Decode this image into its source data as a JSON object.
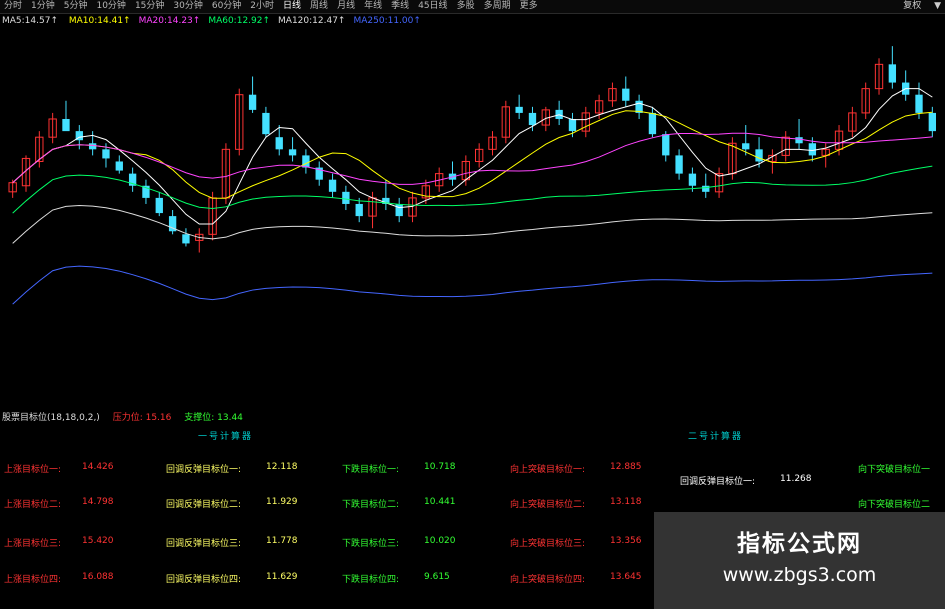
{
  "topbar": {
    "tabs": [
      "分时",
      "1分钟",
      "5分钟",
      "10分钟",
      "15分钟",
      "30分钟",
      "60分钟",
      "2小时",
      "日线",
      "周线",
      "月线",
      "年线",
      "季线",
      "45日线",
      "多股",
      "多周期",
      "更多"
    ],
    "active": "日线",
    "right": [
      "复权",
      "▼"
    ]
  },
  "ma_legend": {
    "name": "MA5:14.57↑",
    "items": [
      {
        "label": "MA10:14.41↑",
        "color": "#ffff00"
      },
      {
        "label": "MA20:14.23↑",
        "color": "#ff44ff"
      },
      {
        "label": "MA60:12.92↑",
        "color": "#00ff66"
      },
      {
        "label": "MA120:12.47↑",
        "color": "#dddddd"
      },
      {
        "label": "MA250:11.00↑",
        "color": "#4466ff"
      }
    ]
  },
  "chart_data": {
    "type": "candlestick",
    "ylim": [
      10.5,
      16.2
    ],
    "candles": [
      [
        13.6,
        13.8,
        13.5,
        13.75
      ],
      [
        13.7,
        14.2,
        13.6,
        14.15
      ],
      [
        14.1,
        14.6,
        14.0,
        14.5
      ],
      [
        14.5,
        14.9,
        14.4,
        14.8
      ],
      [
        14.8,
        15.1,
        14.7,
        14.6
      ],
      [
        14.6,
        14.7,
        14.3,
        14.45
      ],
      [
        14.4,
        14.6,
        14.2,
        14.3
      ],
      [
        14.3,
        14.4,
        14.0,
        14.15
      ],
      [
        14.1,
        14.2,
        13.9,
        13.95
      ],
      [
        13.9,
        14.0,
        13.6,
        13.7
      ],
      [
        13.7,
        13.8,
        13.4,
        13.5
      ],
      [
        13.5,
        13.6,
        13.2,
        13.25
      ],
      [
        13.2,
        13.3,
        12.9,
        12.95
      ],
      [
        12.9,
        13.0,
        12.7,
        12.75
      ],
      [
        12.8,
        13.0,
        12.6,
        12.9
      ],
      [
        12.9,
        13.6,
        12.8,
        13.5
      ],
      [
        13.5,
        14.4,
        13.4,
        14.3
      ],
      [
        14.3,
        15.3,
        14.2,
        15.2
      ],
      [
        15.2,
        15.5,
        14.9,
        14.95
      ],
      [
        14.9,
        15.0,
        14.5,
        14.55
      ],
      [
        14.5,
        14.7,
        14.2,
        14.3
      ],
      [
        14.3,
        14.5,
        14.1,
        14.2
      ],
      [
        14.2,
        14.3,
        13.9,
        14.0
      ],
      [
        14.0,
        14.1,
        13.7,
        13.8
      ],
      [
        13.8,
        13.9,
        13.5,
        13.6
      ],
      [
        13.6,
        13.7,
        13.3,
        13.4
      ],
      [
        13.4,
        13.5,
        13.1,
        13.2
      ],
      [
        13.2,
        13.6,
        13.0,
        13.5
      ],
      [
        13.5,
        13.8,
        13.3,
        13.4
      ],
      [
        13.4,
        13.5,
        13.1,
        13.2
      ],
      [
        13.2,
        13.6,
        13.1,
        13.5
      ],
      [
        13.5,
        13.8,
        13.4,
        13.7
      ],
      [
        13.7,
        14.0,
        13.6,
        13.9
      ],
      [
        13.9,
        14.1,
        13.7,
        13.8
      ],
      [
        13.8,
        14.2,
        13.7,
        14.1
      ],
      [
        14.1,
        14.4,
        14.0,
        14.3
      ],
      [
        14.3,
        14.6,
        14.2,
        14.5
      ],
      [
        14.5,
        15.1,
        14.4,
        15.0
      ],
      [
        15.0,
        15.2,
        14.8,
        14.9
      ],
      [
        14.9,
        15.0,
        14.6,
        14.7
      ],
      [
        14.7,
        15.0,
        14.6,
        14.95
      ],
      [
        14.95,
        15.1,
        14.7,
        14.8
      ],
      [
        14.8,
        14.9,
        14.5,
        14.6
      ],
      [
        14.6,
        15.0,
        14.5,
        14.9
      ],
      [
        14.9,
        15.2,
        14.8,
        15.1
      ],
      [
        15.1,
        15.4,
        15.0,
        15.3
      ],
      [
        15.3,
        15.5,
        15.0,
        15.1
      ],
      [
        15.1,
        15.2,
        14.8,
        14.9
      ],
      [
        14.9,
        15.0,
        14.5,
        14.55
      ],
      [
        14.55,
        14.6,
        14.1,
        14.2
      ],
      [
        14.2,
        14.3,
        13.8,
        13.9
      ],
      [
        13.9,
        14.0,
        13.6,
        13.7
      ],
      [
        13.7,
        13.9,
        13.5,
        13.6
      ],
      [
        13.6,
        14.0,
        13.5,
        13.9
      ],
      [
        13.9,
        14.5,
        13.8,
        14.4
      ],
      [
        14.4,
        14.7,
        14.2,
        14.3
      ],
      [
        14.3,
        14.5,
        14.0,
        14.1
      ],
      [
        14.1,
        14.3,
        13.9,
        14.2
      ],
      [
        14.2,
        14.6,
        14.1,
        14.5
      ],
      [
        14.5,
        14.8,
        14.3,
        14.4
      ],
      [
        14.4,
        14.5,
        14.1,
        14.2
      ],
      [
        14.2,
        14.4,
        14.0,
        14.3
      ],
      [
        14.3,
        14.7,
        14.2,
        14.6
      ],
      [
        14.6,
        15.0,
        14.5,
        14.9
      ],
      [
        14.9,
        15.4,
        14.8,
        15.3
      ],
      [
        15.3,
        15.8,
        15.2,
        15.7
      ],
      [
        15.7,
        16.0,
        15.3,
        15.4
      ],
      [
        15.4,
        15.6,
        15.1,
        15.2
      ],
      [
        15.2,
        15.4,
        14.8,
        14.9
      ],
      [
        14.9,
        15.0,
        14.5,
        14.6
      ]
    ],
    "ma_lines": [
      {
        "name": "MA5",
        "color": "#ffffff"
      },
      {
        "name": "MA10",
        "color": "#ffff00"
      },
      {
        "name": "MA20",
        "color": "#ff44ff"
      },
      {
        "name": "MA60",
        "color": "#00ff66"
      },
      {
        "name": "MA120",
        "color": "#dddddd"
      },
      {
        "name": "MA250",
        "color": "#4466ff"
      }
    ]
  },
  "lower_header": {
    "name": "股票目标位(18,18,0,2,)",
    "items": [
      {
        "label": "压力位: 15.16",
        "color": "#ff3333"
      },
      {
        "label": "支撑位: 13.44",
        "color": "#33ff33"
      }
    ]
  },
  "sections": [
    "一号计算器",
    "二号计算器"
  ],
  "targets": [
    {
      "label": "上涨目标位一:",
      "value": "14.426",
      "color": "#ff3333"
    },
    {
      "label": "上涨目标位二:",
      "value": "14.798",
      "color": "#ff3333"
    },
    {
      "label": "上涨目标位三:",
      "value": "15.420",
      "color": "#ff3333"
    },
    {
      "label": "上涨目标位四:",
      "value": "16.088",
      "color": "#ff3333"
    },
    {
      "label": "回调反弹目标位一:",
      "value": "12.118",
      "color": "#ffff66"
    },
    {
      "label": "回调反弹目标位二:",
      "value": "11.929",
      "color": "#ffff66"
    },
    {
      "label": "回调反弹目标位三:",
      "value": "11.778",
      "color": "#ffff66"
    },
    {
      "label": "回调反弹目标位四:",
      "value": "11.629",
      "color": "#ffff66"
    },
    {
      "label": "下跌目标位一:",
      "value": "10.718",
      "color": "#33ff33"
    },
    {
      "label": "下跌目标位二:",
      "value": "10.441",
      "color": "#33ff33"
    },
    {
      "label": "下跌目标位三:",
      "value": "10.020",
      "color": "#33ff33"
    },
    {
      "label": "下跌目标位四:",
      "value": "9.615",
      "color": "#33ff33"
    },
    {
      "label": "向上突破目标位一:",
      "value": "12.885",
      "color": "#ff3333"
    },
    {
      "label": "向上突破目标位二:",
      "value": "13.118",
      "color": "#ff3333"
    },
    {
      "label": "向上突破目标位三:",
      "value": "13.356",
      "color": "#ff3333"
    },
    {
      "label": "向上突破目标位四:",
      "value": "13.645",
      "color": "#ff3333"
    },
    {
      "label": "回调反弹目标位一:",
      "value": "11.268",
      "color": "#ffffff"
    },
    {
      "label": "向下突破目标位一",
      "value": "",
      "color": "#33ff33"
    },
    {
      "label": "向下突破目标位二",
      "value": "",
      "color": "#33ff33"
    }
  ],
  "watermark": {
    "title": "指标公式网",
    "url": "www.zbgs3.com"
  }
}
